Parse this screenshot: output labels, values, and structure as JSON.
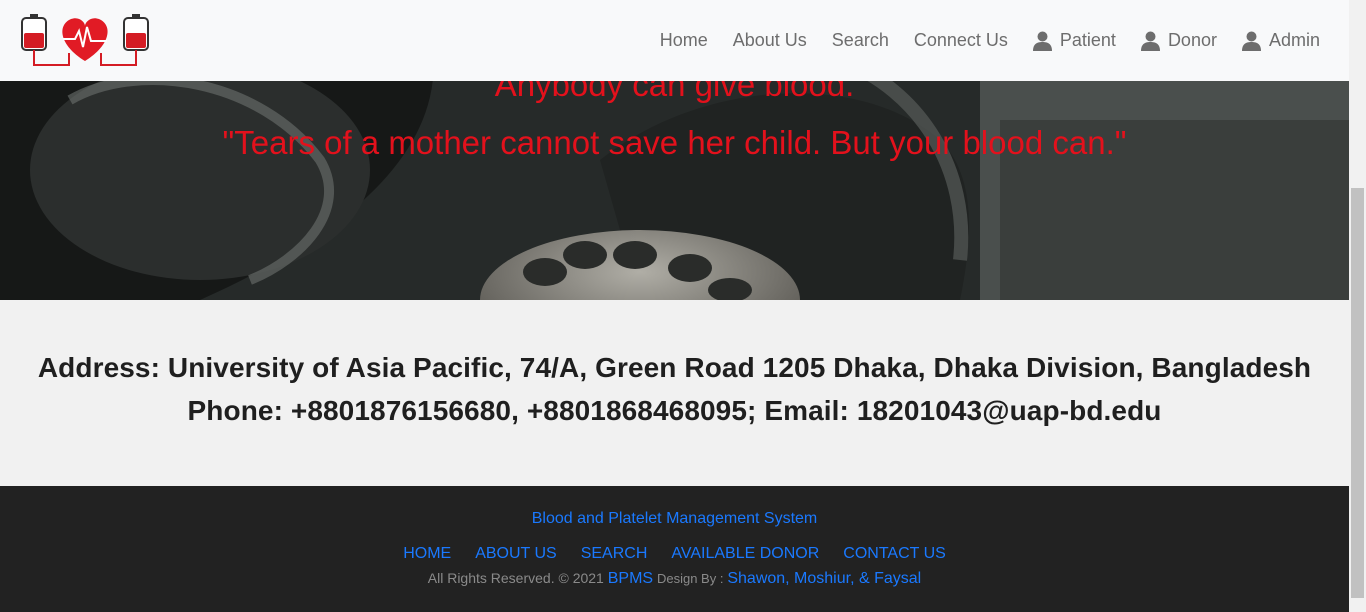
{
  "nav": {
    "items": [
      {
        "label": "Home"
      },
      {
        "label": "About Us"
      },
      {
        "label": "Search"
      },
      {
        "label": "Connect Us"
      }
    ],
    "user_items": [
      {
        "label": "Patient",
        "icon": "user-icon"
      },
      {
        "label": "Donor",
        "icon": "user-icon"
      },
      {
        "label": "Admin",
        "icon": "user-icon"
      }
    ]
  },
  "logo": {
    "icon": "blood-bag-heart-logo"
  },
  "hero": {
    "quote1": "Anybody can give blood.",
    "quote2": "\"Tears of a mother cannot save her child. But your blood can.\""
  },
  "contact": {
    "address": "Address: University of Asia Pacific, 74/A, Green Road 1205 Dhaka, Dhaka Division, Bangladesh",
    "phone": "Phone: +8801876156680, +8801868468095; Email: 18201043@uap-bd.edu"
  },
  "footer": {
    "system_name": "Blood and Platelet Management System",
    "links": [
      "HOME",
      "ABOUT US",
      "SEARCH",
      "AVAILABLE DONOR",
      "CONTACT US"
    ],
    "rights": "All Rights Reserved. © 2021",
    "brand": "BPMS",
    "design_by": "Design By :",
    "designers": "Shawon, Moshiur, & Faysal"
  },
  "colors": {
    "accent": "#1a79ff",
    "quote": "#e3111c",
    "footer_bg": "#222222"
  }
}
